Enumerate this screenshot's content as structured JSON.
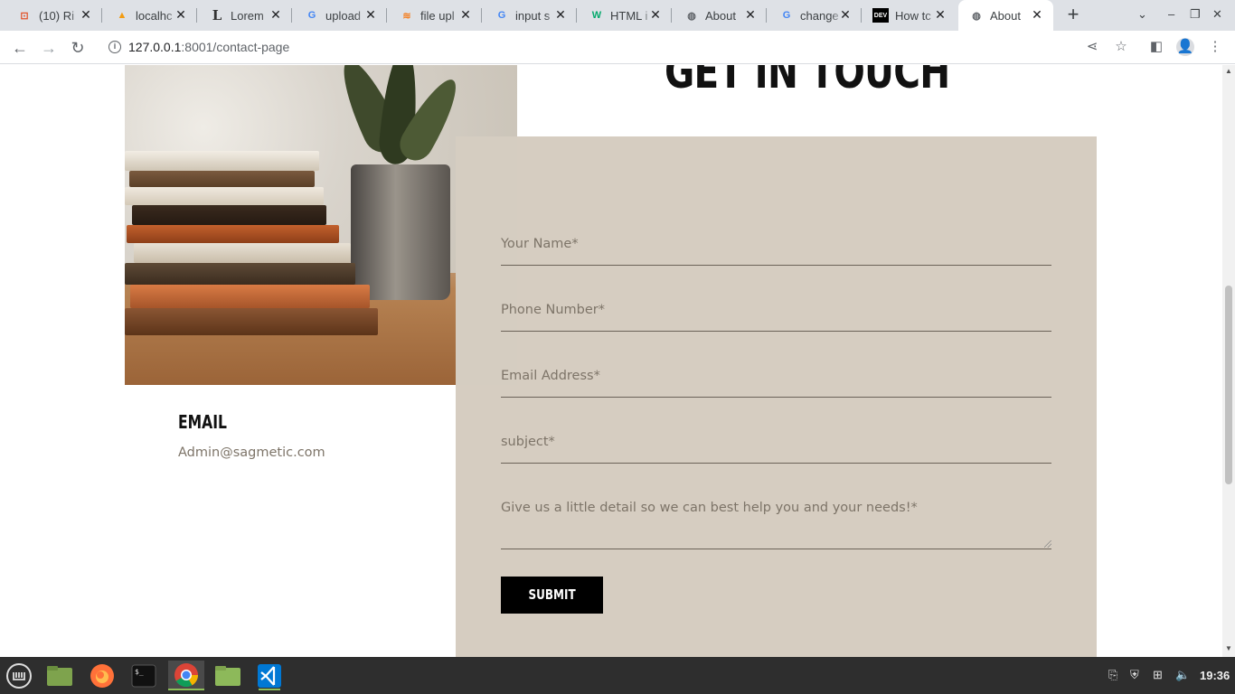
{
  "browser": {
    "tabs": [
      {
        "title": "(10) Ri",
        "favicon": "reddit-like-icon",
        "color": "#e2552d"
      },
      {
        "title": "localhc",
        "favicon": "phpmyadmin-icon",
        "color": "#f39c12"
      },
      {
        "title": "Lorem",
        "favicon": "lipsum-icon",
        "color": "#333333"
      },
      {
        "title": "upload",
        "favicon": "google-icon",
        "color": "#4285f4"
      },
      {
        "title": "file upl",
        "favicon": "stackoverflow-icon",
        "color": "#f48024"
      },
      {
        "title": "input s",
        "favicon": "google-icon",
        "color": "#4285f4"
      },
      {
        "title": "HTML i",
        "favicon": "w3schools-icon",
        "color": "#04aa6d"
      },
      {
        "title": "About",
        "favicon": "globe-icon",
        "color": "#5f6368"
      },
      {
        "title": "change",
        "favicon": "google-icon",
        "color": "#4285f4"
      },
      {
        "title": "How tc",
        "favicon": "dev-icon",
        "color": "#000000"
      },
      {
        "title": "About",
        "favicon": "globe-icon",
        "color": "#5f6368",
        "active": true
      }
    ],
    "url_host": "127.0.0.1",
    "url_path": ":8001/contact-page"
  },
  "page": {
    "heading": "GET IN TOUCH",
    "form": {
      "name_placeholder": "Your Name*",
      "phone_placeholder": "Phone Number*",
      "email_placeholder": "Email Address*",
      "subject_placeholder": "subject*",
      "message_placeholder": "Give us a little detail so we can best help you and your needs!*",
      "submit_label": "SUBMIT"
    },
    "contact": {
      "email_title": "EMAIL",
      "email_value": "Admin@sagmetic.com"
    },
    "colors": {
      "panel": "#d6cdc1",
      "placeholder": "#7d7468",
      "button": "#000000"
    }
  },
  "taskbar": {
    "apps": [
      "menu-icon",
      "files-icon",
      "firefox-icon",
      "terminal-icon",
      "chrome-icon",
      "folder-icon",
      "vscode-icon"
    ],
    "clock": "19:36"
  }
}
